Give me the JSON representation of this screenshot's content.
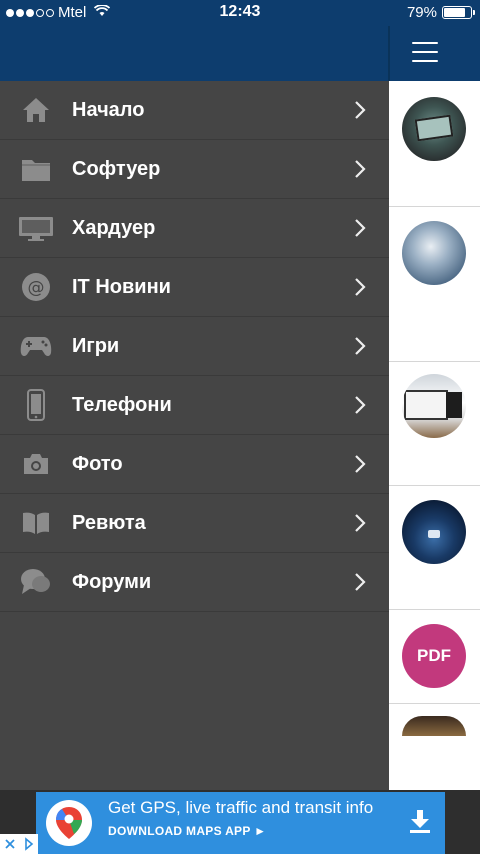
{
  "status_bar": {
    "carrier": "Mtel",
    "time": "12:43",
    "battery": "79%",
    "battery_level": 0.79
  },
  "menu": {
    "items": [
      {
        "label": "Начало",
        "icon": "home-icon"
      },
      {
        "label": "Софтуер",
        "icon": "folder-icon"
      },
      {
        "label": "Хардуер",
        "icon": "monitor-icon"
      },
      {
        "label": "IT Новини",
        "icon": "at-sign-icon"
      },
      {
        "label": "Игри",
        "icon": "gamepad-icon"
      },
      {
        "label": "Телефони",
        "icon": "phone-icon"
      },
      {
        "label": "Фото",
        "icon": "camera-icon"
      },
      {
        "label": "Ревюта",
        "icon": "book-icon"
      },
      {
        "label": "Форуми",
        "icon": "chat-bubbles-icon"
      }
    ]
  },
  "content": {
    "pdf_thumb_text": "PDF"
  },
  "ad": {
    "title": "Get GPS, live traffic and transit info",
    "cta": "DOWNLOAD MAPS APP ►",
    "colors": {
      "background": "#2f8fde"
    }
  },
  "colors": {
    "header": "#0d3d6e",
    "drawer": "#454545",
    "icon": "#8c8c8c"
  }
}
